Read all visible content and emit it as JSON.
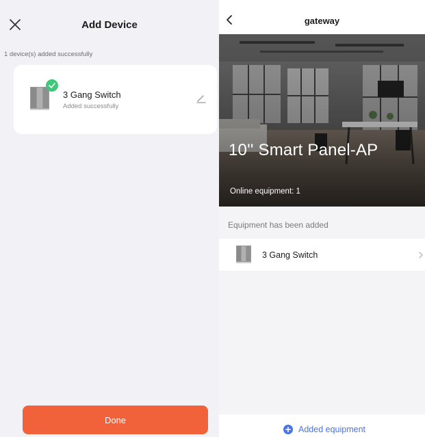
{
  "add_device": {
    "title": "Add Device",
    "added_count": "1 device(s) added successfully",
    "device": {
      "name": "3 Gang Switch",
      "status": "Added successfully"
    },
    "done_label": "Done"
  },
  "gateway": {
    "title": "gateway",
    "panel_name": "10'' Smart Panel-AP",
    "online_equipment": "Online equipment: 1",
    "section_label": "Equipment has been added",
    "equipment": [
      {
        "name": "3 Gang Switch"
      }
    ],
    "add_equipment_label": "Added equipment"
  },
  "colors": {
    "accent_orange": "#f2623a",
    "success_green": "#3ec877",
    "link_blue": "#4a74e6"
  },
  "icons": [
    "close-icon",
    "check-icon",
    "edit-icon",
    "back-icon",
    "switch-device-icon",
    "chevron-right-icon",
    "plus-icon"
  ]
}
